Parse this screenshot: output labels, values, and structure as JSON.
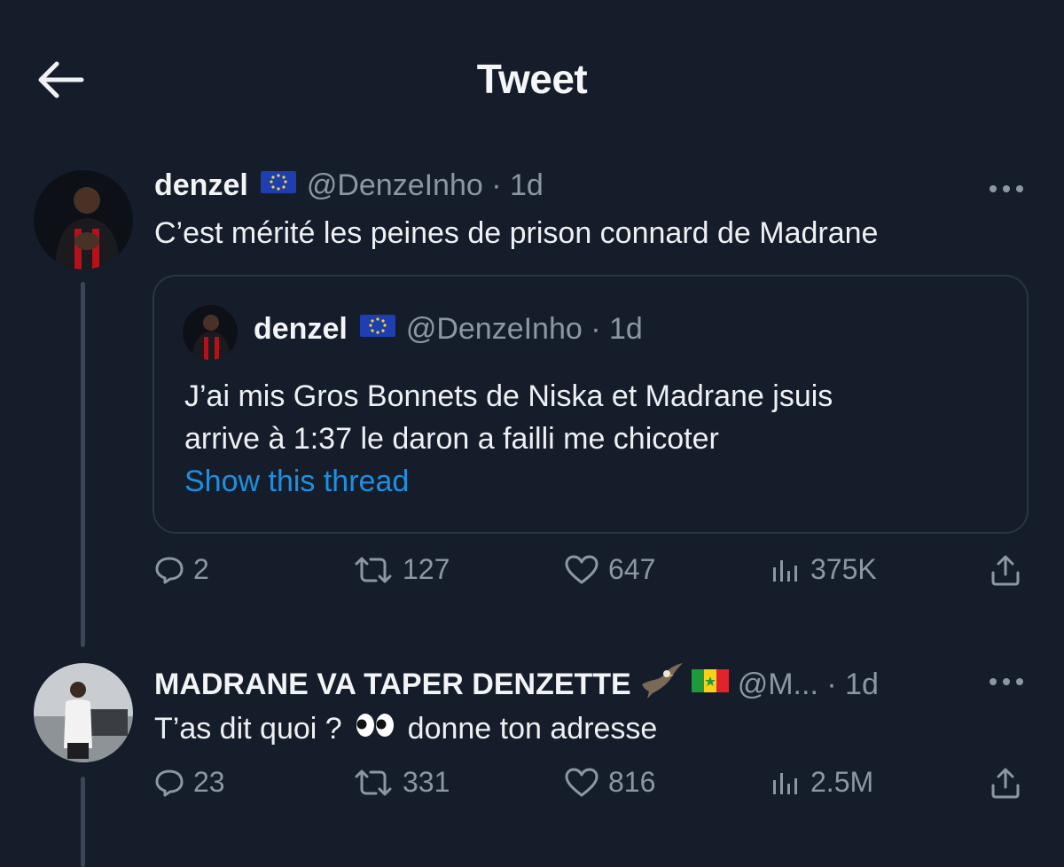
{
  "header": {
    "title": "Tweet"
  },
  "tweet": {
    "name": "denzel",
    "handle": "@DenzeInho · 1d",
    "text": "C’est mérité les peines de prison connard de Madrane",
    "quote": {
      "name": "denzel",
      "handle": "@DenzeInho · 1d",
      "line1": "J’ai mis Gros Bonnets de Niska et Madrane jsuis",
      "line2": "arrive à 1:37 le daron a failli me chicoter",
      "show_thread": "Show this thread"
    },
    "stats": {
      "replies": "2",
      "retweets": "127",
      "likes": "647",
      "views": "375K"
    }
  },
  "reply": {
    "name": "MADRANE VA TAPER DENZETTE",
    "handle": "@M... · 1d",
    "text_before": "T’as dit quoi ?",
    "text_after": "donne ton adresse",
    "stats": {
      "replies": "23",
      "retweets": "331",
      "likes": "816",
      "views": "2.5M"
    }
  },
  "colors": {
    "background": "#151d2b",
    "link": "#1d8fe0",
    "muted": "#8d97a3",
    "border": "#2a3444"
  }
}
